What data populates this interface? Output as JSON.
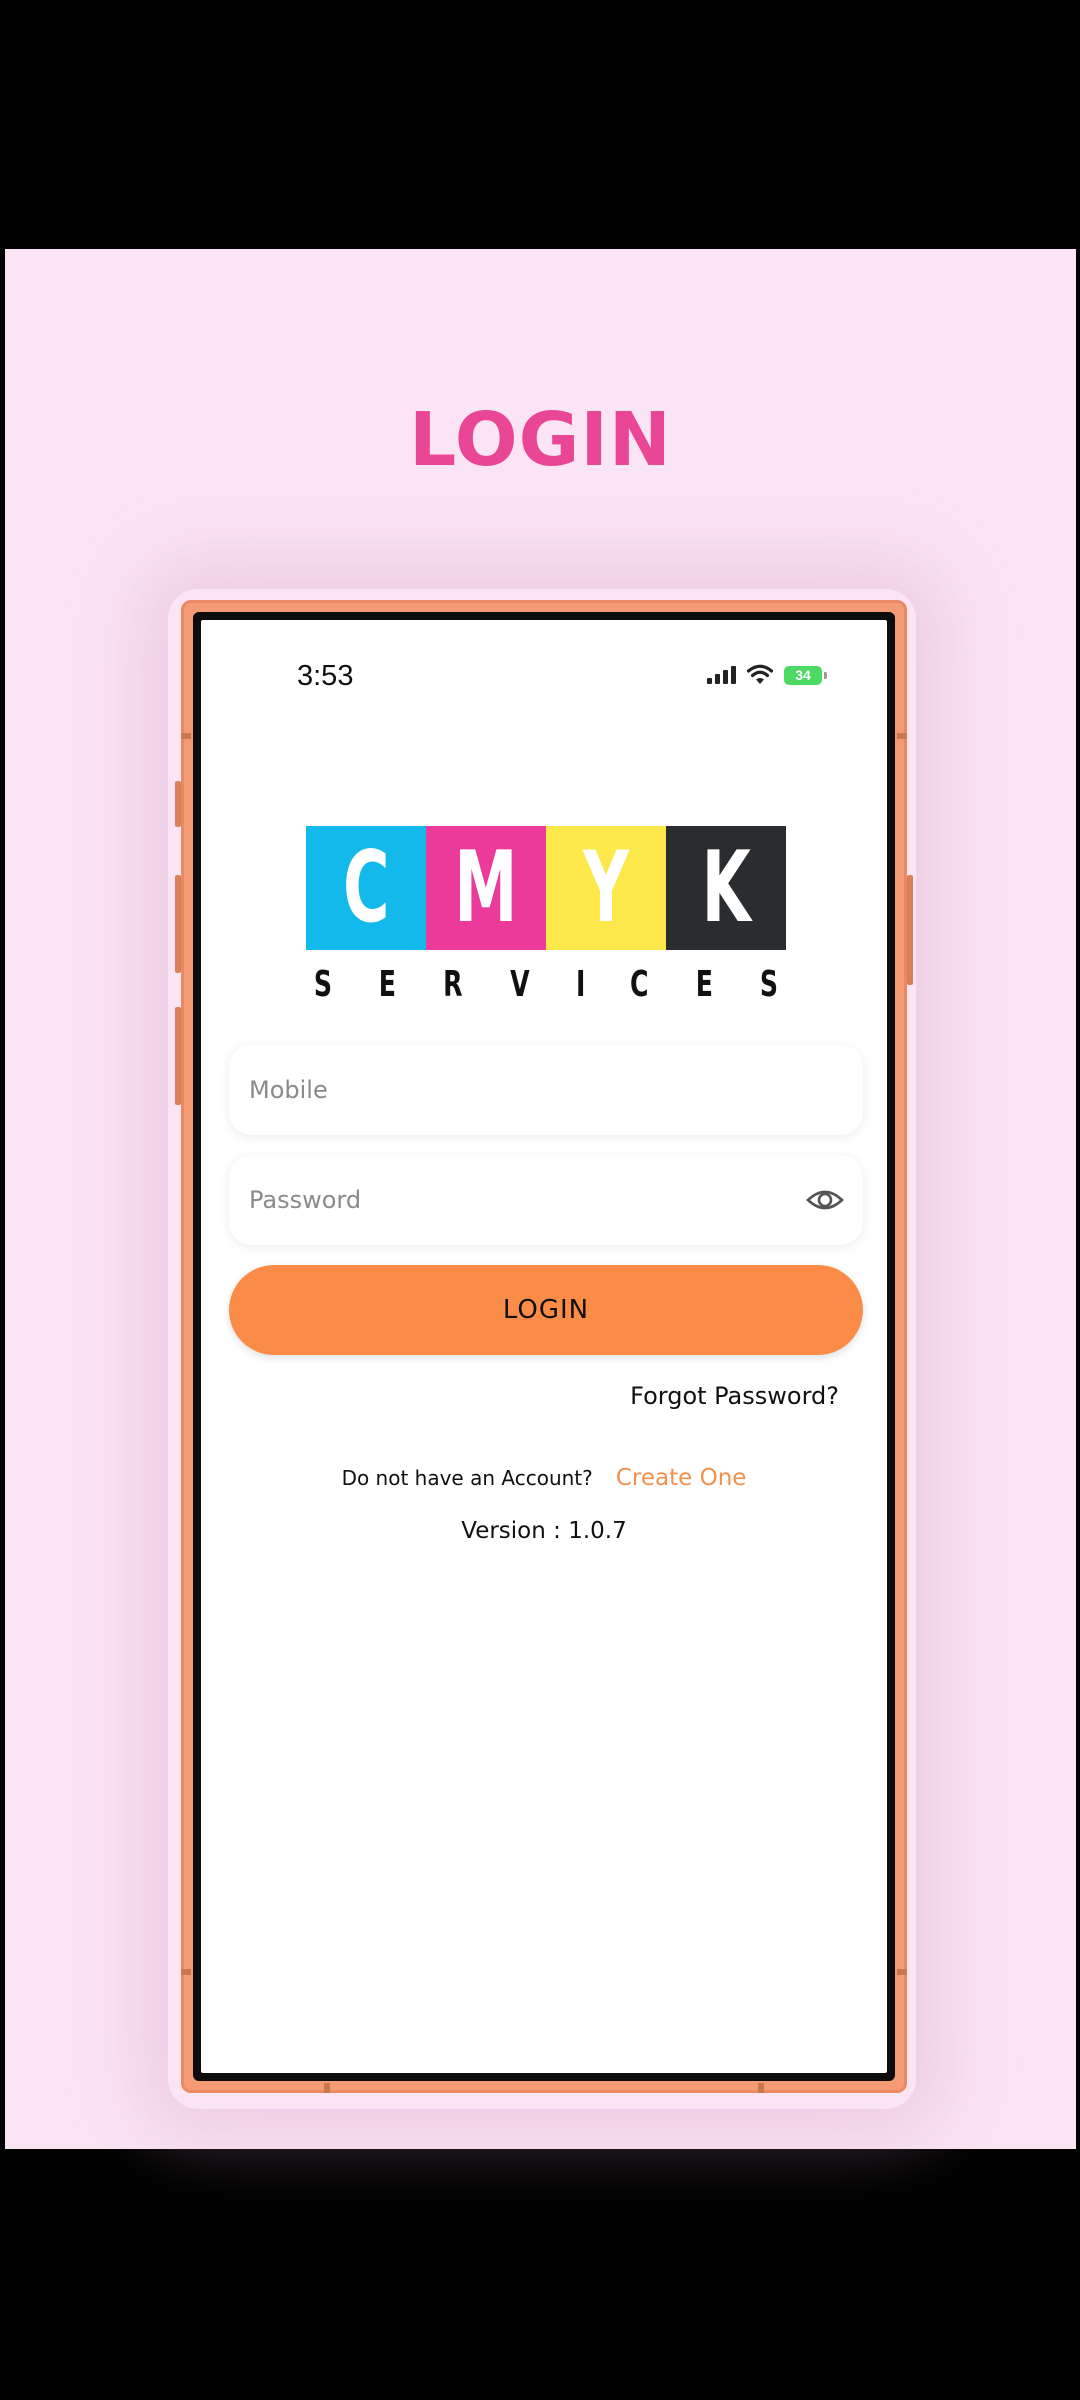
{
  "page": {
    "title": "LOGIN"
  },
  "status_bar": {
    "time": "3:53",
    "battery": "34"
  },
  "logo": {
    "letters": [
      {
        "char": "C",
        "color": "#14b9ec"
      },
      {
        "char": "M",
        "color": "#ec3a9a"
      },
      {
        "char": "Y",
        "color": "#fce84a"
      },
      {
        "char": "K",
        "color": "#2a2d30"
      }
    ],
    "subtitle_letters": [
      "S",
      "E",
      "R",
      "V",
      "I",
      "C",
      "E",
      "S"
    ]
  },
  "form": {
    "mobile_placeholder": "Mobile",
    "password_placeholder": "Password",
    "login_label": "LOGIN",
    "forgot_label": "Forgot Password?",
    "no_account_text": "Do not have an Account?",
    "create_label": "Create One",
    "version_text": "Version : 1.0.7"
  },
  "colors": {
    "background": "#fbe4f4",
    "title": "#e94795",
    "phone_frame": "#f49b75",
    "login_button": "#fb8c47",
    "create_link": "#f2914f"
  }
}
